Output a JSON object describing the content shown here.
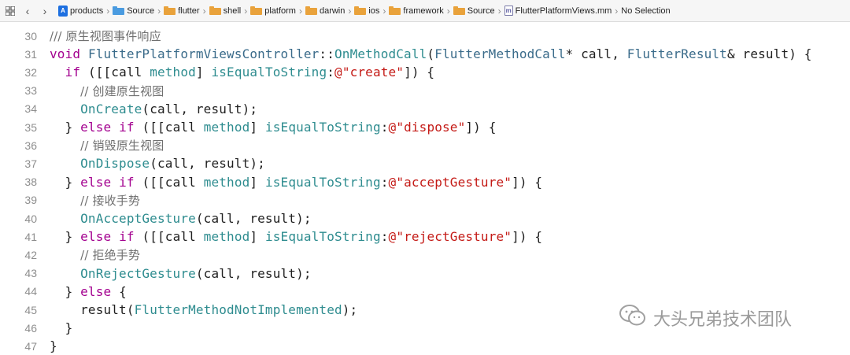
{
  "jumpbar": {
    "crumbs": [
      {
        "label": "products",
        "icon": "project-icon"
      },
      {
        "label": "Source",
        "icon": "folder-icon"
      },
      {
        "label": "flutter",
        "icon": "folder-icon"
      },
      {
        "label": "shell",
        "icon": "folder-icon"
      },
      {
        "label": "platform",
        "icon": "folder-icon"
      },
      {
        "label": "darwin",
        "icon": "folder-icon"
      },
      {
        "label": "ios",
        "icon": "folder-icon"
      },
      {
        "label": "framework",
        "icon": "folder-icon"
      },
      {
        "label": "Source",
        "icon": "folder-icon"
      },
      {
        "label": "FlutterPlatformViews.mm",
        "icon": "objc-file-icon"
      },
      {
        "label": "No Selection",
        "icon": ""
      }
    ]
  },
  "editor": {
    "lines": [
      {
        "n": "30",
        "c": "/// 原生视图事件响应"
      },
      {
        "n": "31",
        "c": "void FlutterPlatformViewsController::OnMethodCall(FlutterMethodCall* call, FlutterResult& result) {"
      },
      {
        "n": "32",
        "c": "  if ([[call method] isEqualToString:@\"create\"]) {"
      },
      {
        "n": "33",
        "c": "    // 创建原生视图"
      },
      {
        "n": "34",
        "c": "    OnCreate(call, result);"
      },
      {
        "n": "35",
        "c": "  } else if ([[call method] isEqualToString:@\"dispose\"]) {"
      },
      {
        "n": "36",
        "c": "    // 销毁原生视图"
      },
      {
        "n": "37",
        "c": "    OnDispose(call, result);"
      },
      {
        "n": "38",
        "c": "  } else if ([[call method] isEqualToString:@\"acceptGesture\"]) {"
      },
      {
        "n": "39",
        "c": "    // 接收手势"
      },
      {
        "n": "40",
        "c": "    OnAcceptGesture(call, result);"
      },
      {
        "n": "41",
        "c": "  } else if ([[call method] isEqualToString:@\"rejectGesture\"]) {"
      },
      {
        "n": "42",
        "c": "    // 拒绝手势"
      },
      {
        "n": "43",
        "c": "    OnRejectGesture(call, result);"
      },
      {
        "n": "44",
        "c": "  } else {"
      },
      {
        "n": "45",
        "c": "    result(FlutterMethodNotImplemented);"
      },
      {
        "n": "46",
        "c": "  }"
      },
      {
        "n": "47",
        "c": "}"
      }
    ]
  },
  "watermark": {
    "text": "大头兄弟技术团队"
  },
  "colors": {
    "keyword": "#a3008f",
    "type": "#3a6b8a",
    "function": "#2e8c8f",
    "string": "#c41a16",
    "comment": "#707070",
    "line_number": "#8e8e8e"
  }
}
